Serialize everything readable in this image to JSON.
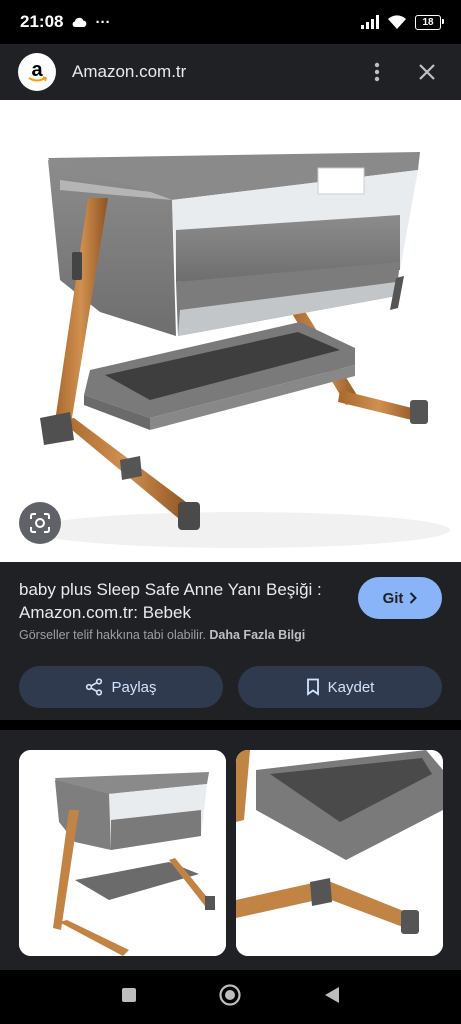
{
  "status_bar": {
    "time": "21:08",
    "dots": "···",
    "battery": "18"
  },
  "header": {
    "site": "Amazon.com.tr"
  },
  "result": {
    "title": "baby plus Sleep Safe Anne Yanı Beşiği : Amazon.com.tr: Bebek",
    "go_label": "Git",
    "notice": "Görseller telif hakkına tabi olabilir.",
    "more_info": "Daha Fazla Bilgi",
    "share_label": "Paylaş",
    "save_label": "Kaydet"
  },
  "colors": {
    "accent": "#8ab4f8",
    "surface": "#202124",
    "button": "#303a4f"
  }
}
